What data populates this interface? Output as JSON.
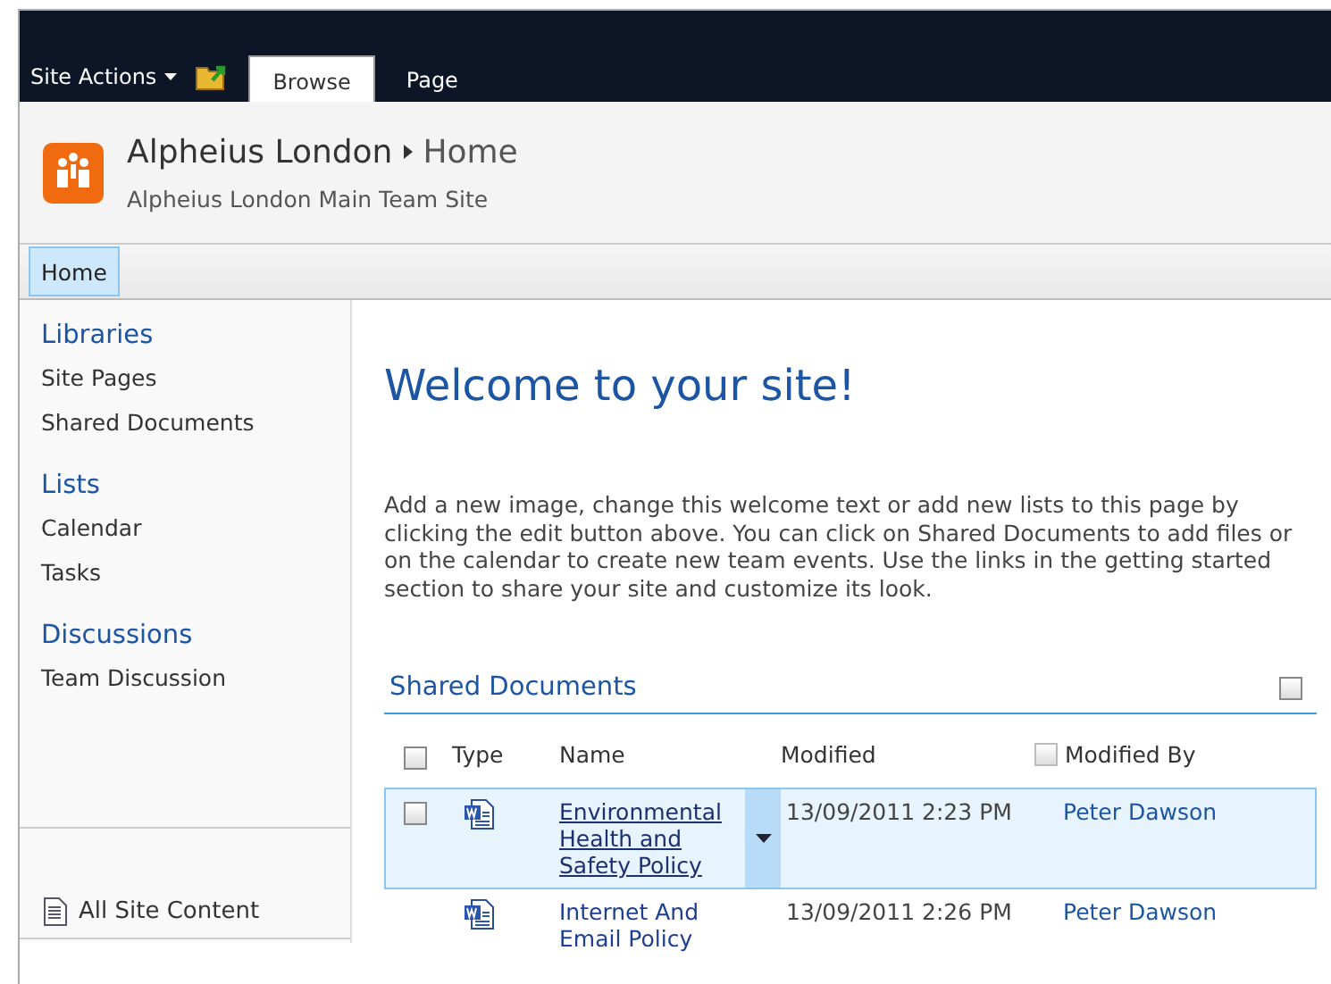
{
  "ribbon": {
    "site_actions": "Site Actions",
    "tabs": [
      {
        "label": "Browse",
        "selected": true
      },
      {
        "label": "Page",
        "selected": false
      }
    ]
  },
  "header": {
    "site": "Alpheius London",
    "page": "Home",
    "description": "Alpheius London Main Team Site"
  },
  "top_nav": [
    {
      "label": "Home",
      "selected": true
    }
  ],
  "sidebar": {
    "groups": [
      {
        "heading": "Libraries",
        "items": [
          "Site Pages",
          "Shared Documents"
        ]
      },
      {
        "heading": "Lists",
        "items": [
          "Calendar",
          "Tasks"
        ]
      },
      {
        "heading": "Discussions",
        "items": [
          "Team Discussion"
        ]
      }
    ],
    "all_content": "All Site Content"
  },
  "main": {
    "title": "Welcome to your site!",
    "intro": "Add a new image, change this welcome text or add new lists to this page by clicking the edit button above. You can click on Shared Documents to add files or on the calendar to create new team events. Use the links in the getting started section to share your site and customize its look.",
    "list": {
      "title": "Shared Documents",
      "title_checkbox": {
        "checked": false
      },
      "select_all": {
        "checked": false
      },
      "modified_by_checkbox": {
        "checked": false
      },
      "columns": [
        "Type",
        "Name",
        "Modified",
        "Modified By"
      ],
      "rows": [
        {
          "name": "Environmental Health and Safety Policy",
          "modified": "13/09/2011 2:23 PM",
          "modified_by": "Peter Dawson",
          "selected": true
        },
        {
          "name": "Internet And Email Policy",
          "modified": "13/09/2011 2:26 PM",
          "modified_by": "Peter Dawson",
          "selected": false
        }
      ]
    }
  }
}
